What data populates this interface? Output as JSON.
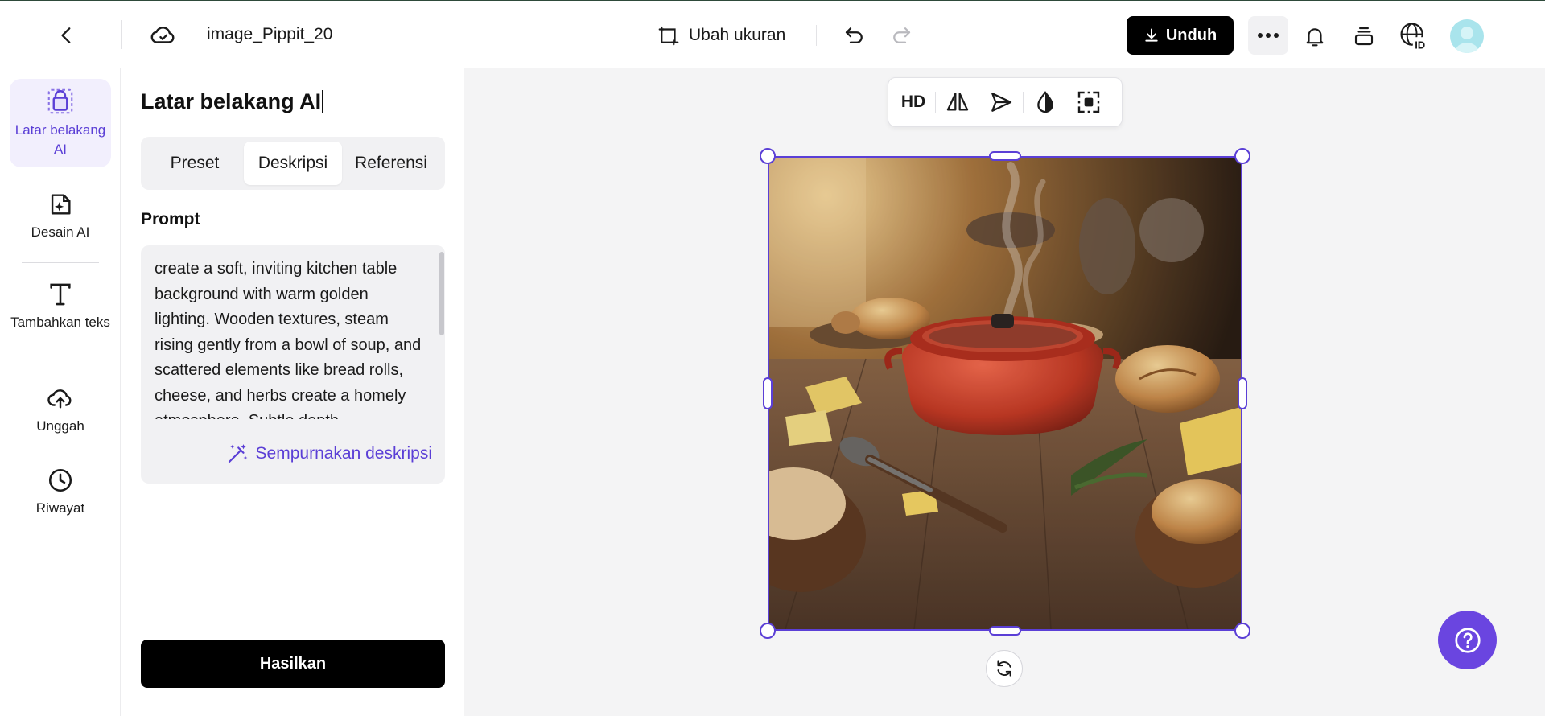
{
  "header": {
    "filename": "image_Pippit_20",
    "resize_label": "Ubah ukuran",
    "download_label": "Unduh",
    "icons": [
      "chevron-left-icon",
      "cloud-sync-icon",
      "resize-icon",
      "undo-icon",
      "redo-icon",
      "download-icon",
      "more-icon",
      "bell-icon",
      "stack-icon",
      "globe-id-icon",
      "avatar"
    ]
  },
  "sidebar": {
    "items": [
      {
        "label": "Latar belakang AI",
        "icon": "ai-background-icon",
        "active": true
      },
      {
        "label": "Desain AI",
        "icon": "ai-design-icon",
        "active": false
      },
      {
        "label": "Tambahkan teks",
        "icon": "text-icon",
        "active": false
      },
      {
        "label": "Unggah",
        "icon": "upload-cloud-icon",
        "active": false
      },
      {
        "label": "Riwayat",
        "icon": "history-clock-icon",
        "active": false
      }
    ]
  },
  "panel": {
    "title": "Latar belakang AI",
    "tabs": [
      {
        "label": "Preset",
        "active": false
      },
      {
        "label": "Deskripsi",
        "active": true
      },
      {
        "label": "Referensi",
        "active": false
      }
    ],
    "prompt_label": "Prompt",
    "prompt_text": "create a soft, inviting kitchen table background with warm golden lighting. Wooden textures, steam rising gently from a bowl of soup, and scattered elements like bread rolls, cheese, and herbs create a homely atmosphere. Subtle depth",
    "refine_label": "Sempurnakan deskripsi",
    "generate_label": "Hasilkan"
  },
  "canvas": {
    "toolbar": {
      "hd_label": "HD",
      "icons": [
        "flip-icon",
        "send-icon",
        "droplet-icon",
        "focus-select-icon"
      ]
    },
    "image_alt": "Red cast-iron pot on a wooden kitchen table with bread, cheese, herbs and steam",
    "rotate_icon": "rotate-icon",
    "help_icon": "help-icon"
  },
  "colors": {
    "accent": "#5b3fd6",
    "help_button": "#6a45e0",
    "active_bg": "#f2effd"
  }
}
